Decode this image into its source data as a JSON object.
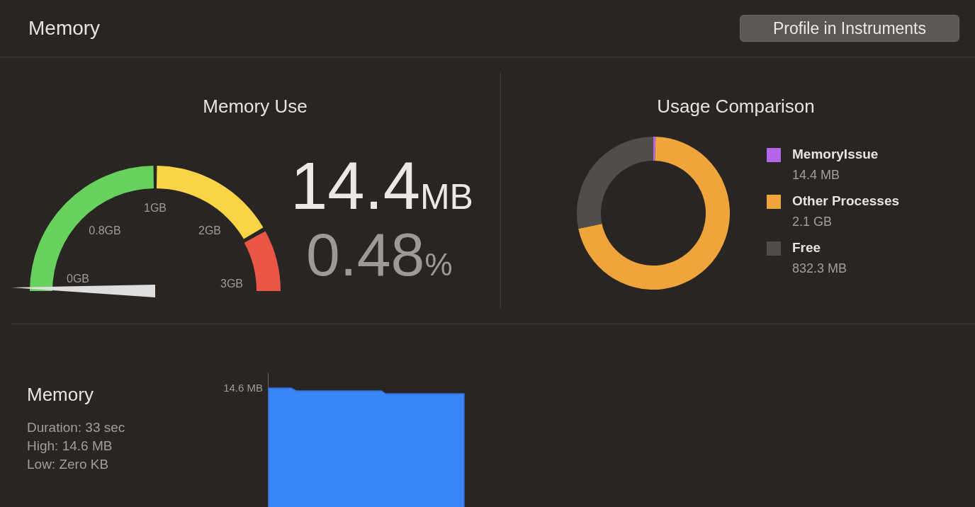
{
  "header": {
    "title": "Memory",
    "button": "Profile in Instruments"
  },
  "memory_use": {
    "title": "Memory Use",
    "gauge": {
      "level": 0,
      "labels": [
        "0GB",
        "0.8GB",
        "1GB",
        "2GB",
        "3GB"
      ]
    },
    "value": "14.4",
    "value_unit": "MB",
    "percent": "0.48",
    "percent_unit": "%"
  },
  "usage_comparison": {
    "title": "Usage Comparison",
    "chart_data": {
      "type": "donut",
      "categories": [
        "MemoryIssue",
        "Other Processes",
        "Free"
      ],
      "series": [
        {
          "values": [
            0.49,
            71.26,
            28.25
          ]
        }
      ]
    },
    "legend": [
      {
        "value": "14.4 MB",
        "color": "#b565eb"
      },
      {
        "value": "2.1 GB",
        "color": "#f0a43c"
      },
      {
        "value": "832.3 MB",
        "color": "#504d4c"
      }
    ]
  },
  "memory_report": {
    "title": "Memory",
    "stats": [
      "Duration: 33 sec",
      "High: 14.6 MB",
      "Low: Zero KB"
    ],
    "axis_label": "14.6 MB"
  }
}
